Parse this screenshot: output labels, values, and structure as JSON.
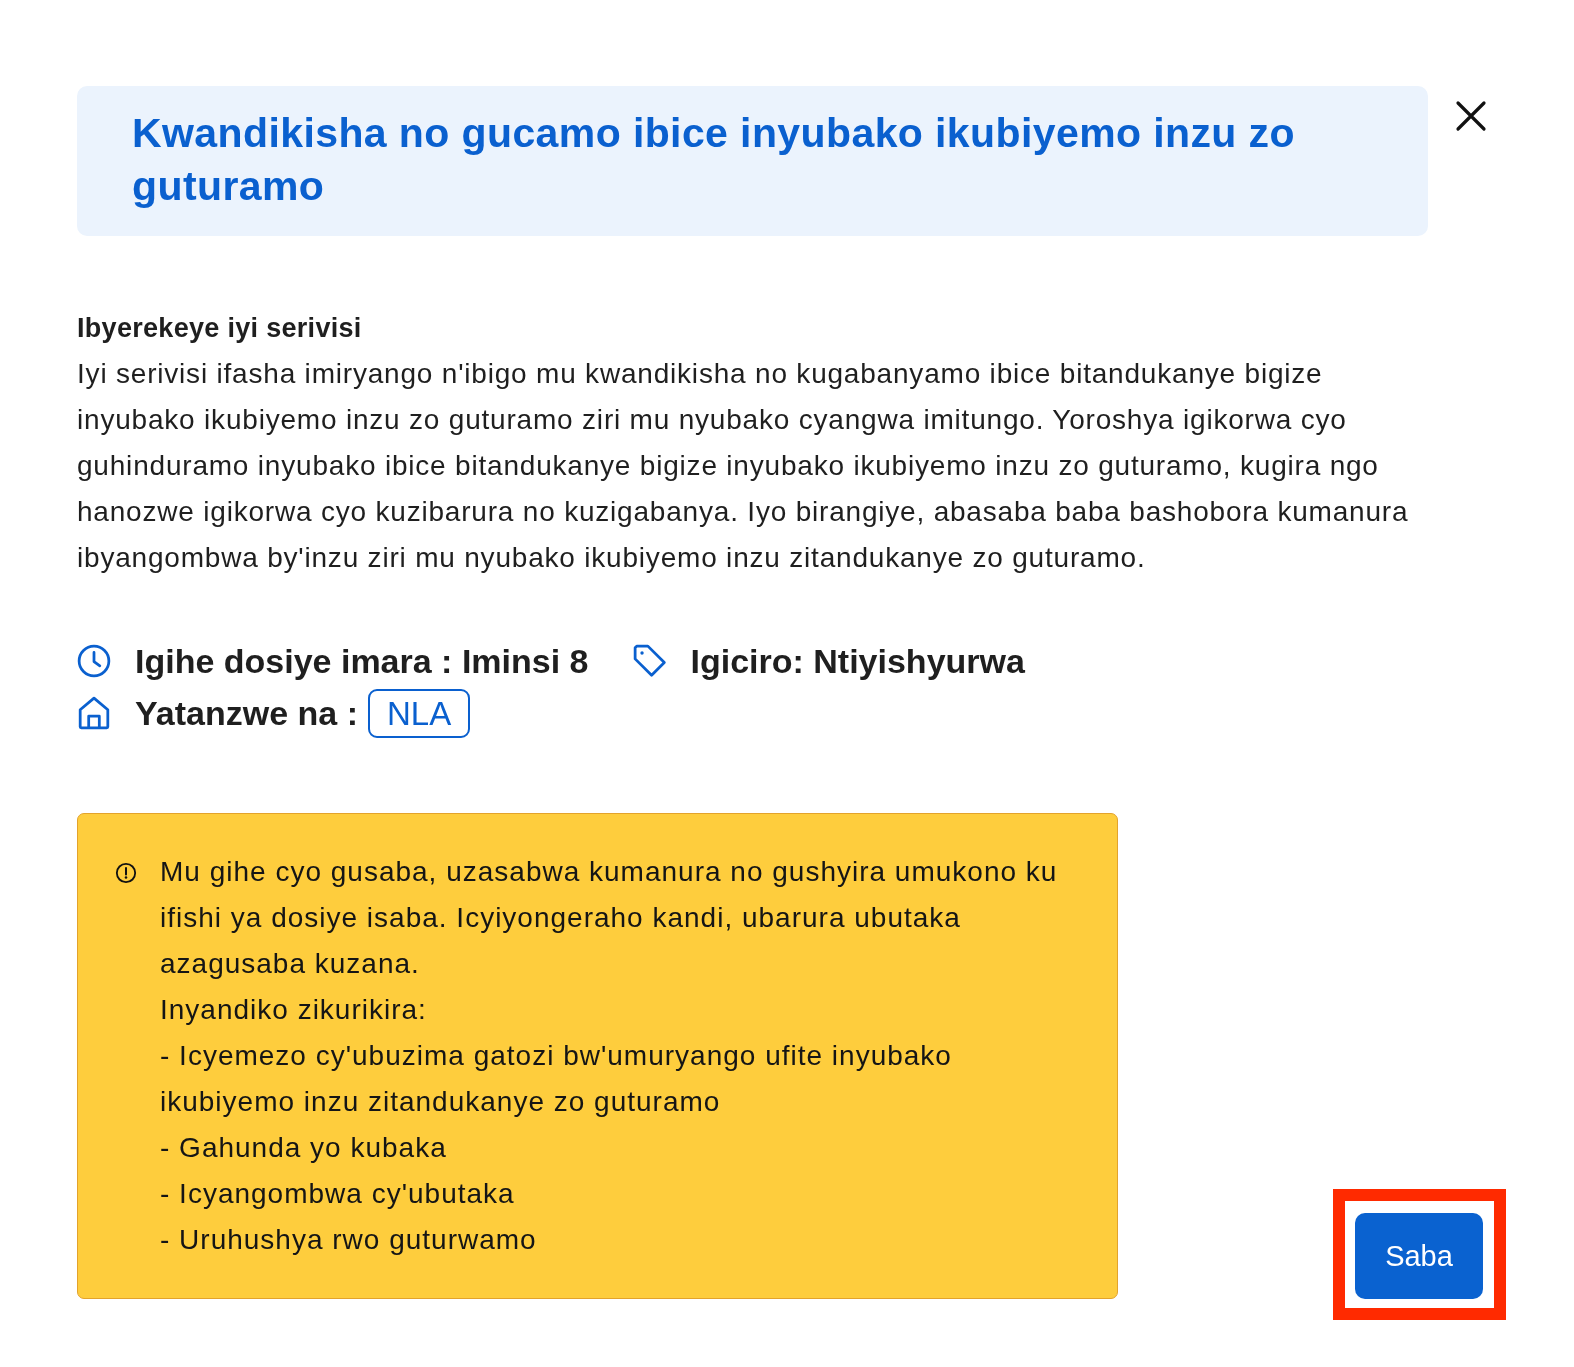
{
  "dialog": {
    "title": "Kwandikisha no gucamo ibice inyubako ikubiyemo inzu zo guturamo"
  },
  "description": {
    "heading": "Ibyerekeye iyi serivisi",
    "text": "Iyi serivisi ifasha imiryango n'ibigo mu kwandikisha no kugabanyamo ibice bitandukanye bigize inyubako ikubiyemo inzu zo guturamo ziri mu nyubako cyangwa imitungo. Yoroshya igikorwa cyo guhinduramo inyubako ibice bitandukanye bigize inyubako ikubiyemo inzu zo guturamo, kugira ngo hanozwe igikorwa cyo kuzibarura no kuzigabanya. Iyo birangiye, abasaba baba bashobora kumanura ibyangombwa by'inzu ziri mu nyubako ikubiyemo inzu zitandukanye zo guturamo."
  },
  "meta": [
    {
      "kind": "duration",
      "text": "Igihe dosiye imara : Iminsi 8"
    },
    {
      "kind": "price",
      "text": "Igiciro: Ntiyishyurwa"
    },
    {
      "kind": "provider",
      "text": "Yatanzwe na :",
      "badge": "NLA"
    }
  ],
  "notice": {
    "paragraphs": [
      "Mu gihe cyo gusaba, uzasabwa kumanura no gushyira umukono ku ifishi ya dosiye isaba. Icyiyongeraho kandi, ubarura ubutaka azagusaba kuzana.",
      "Inyandiko zikurikira:",
      "- Icyemezo cy'ubuzima gatozi bw'umuryango ufite inyubako ikubiyemo inzu zitandukanye zo guturamo",
      "- Gahunda yo kubaka",
      "- Icyangombwa cy'ubutaka",
      "- Uruhushya rwo guturwamo"
    ]
  },
  "submit_button": {
    "label": "Saba",
    "highlighted": true
  }
}
